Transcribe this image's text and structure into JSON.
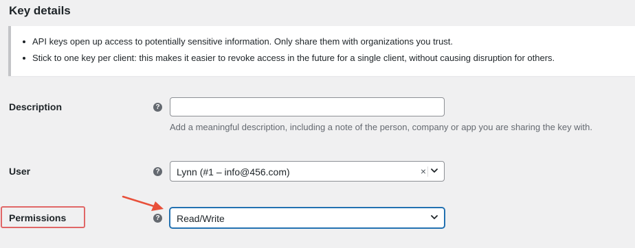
{
  "section": {
    "title": "Key details"
  },
  "notice": {
    "bullets": [
      "API keys open up access to potentially sensitive information. Only share them with organizations you trust.",
      "Stick to one key per client: this makes it easier to revoke access in the future for a single client, without causing disruption for others."
    ]
  },
  "fields": {
    "description": {
      "label": "Description",
      "value": "",
      "help_icon": "?",
      "hint": "Add a meaningful description, including a note of the person, company or app you are sharing the key with."
    },
    "user": {
      "label": "User",
      "help_icon": "?",
      "selected": "Lynn (#1 – info@456.com)",
      "clear_symbol": "×"
    },
    "permissions": {
      "label": "Permissions",
      "help_icon": "?",
      "selected": "Read/Write"
    }
  },
  "annotation": {
    "highlight_color": "#e06666"
  },
  "colors": {
    "accent": "#2271b1",
    "background": "#f0f0f1"
  },
  "icons": {
    "help": "question-circle-icon",
    "dropdown": "chevron-down-icon",
    "clear": "close-icon",
    "annotation": "red-arrow-icon"
  }
}
